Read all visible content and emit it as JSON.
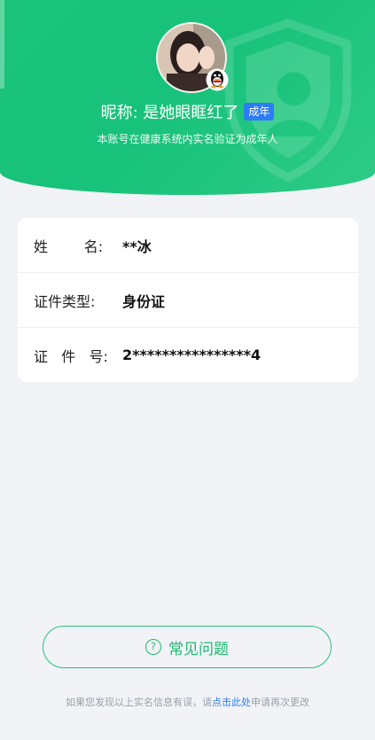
{
  "header": {
    "nickname_label": "昵称: 是她眼眶红了",
    "age_badge": "成年",
    "verify_text": "本账号在健康系统内实名验证为成年人"
  },
  "info": {
    "rows": [
      {
        "label": "姓        名:",
        "value": "**冰"
      },
      {
        "label": "证件类型:",
        "value": "身份证"
      },
      {
        "label": "证   件   号:",
        "value": "2****************4"
      }
    ]
  },
  "faq": {
    "label": "常见问题"
  },
  "footer": {
    "prefix": "如果您发现以上实名信息有误，请",
    "link": "点击此处",
    "suffix": "申请再次更改"
  },
  "colors": {
    "accent": "#1fb96f",
    "badge": "#2f7df6",
    "link": "#2f7df6"
  }
}
